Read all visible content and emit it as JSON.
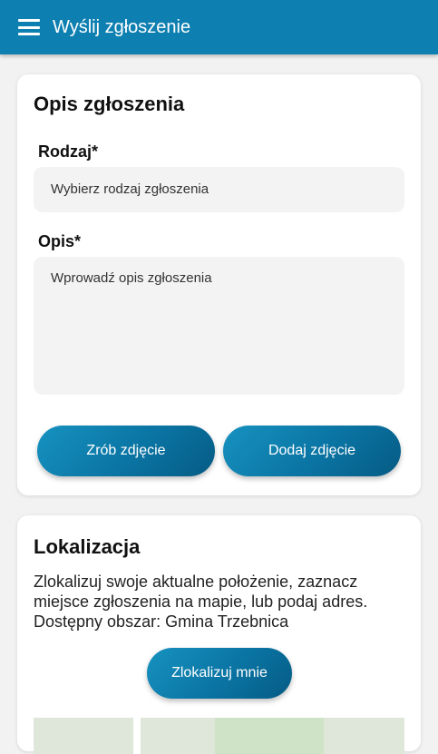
{
  "app_bar": {
    "title": "Wyślij zgłoszenie",
    "menu_icon": "hamburger-menu-icon",
    "color": "#0d7fb0"
  },
  "description_card": {
    "title": "Opis zgłoszenia",
    "type_label": "Rodzaj*",
    "type_placeholder": "Wybierz rodzaj zgłoszenia",
    "desc_label": "Opis*",
    "desc_placeholder": "Wprowadź opis zgłoszenia",
    "take_photo_label": "Zrób zdjęcie",
    "add_photo_label": "Dodaj zdjęcie"
  },
  "location_card": {
    "title": "Lokalizacja",
    "description": "Zlokalizuj swoje aktualne położenie, zaznacz miejsce zgłoszenia na mapie, lub podaj adres. Dostępny obszar: Gmina Trzebnica",
    "locate_label": "Zlokalizuj mnie"
  },
  "colors": {
    "accent": "#0d7fb0",
    "button_dark": "#065b84",
    "background": "#f2f2f2",
    "input_bg": "#f3f3f3"
  }
}
